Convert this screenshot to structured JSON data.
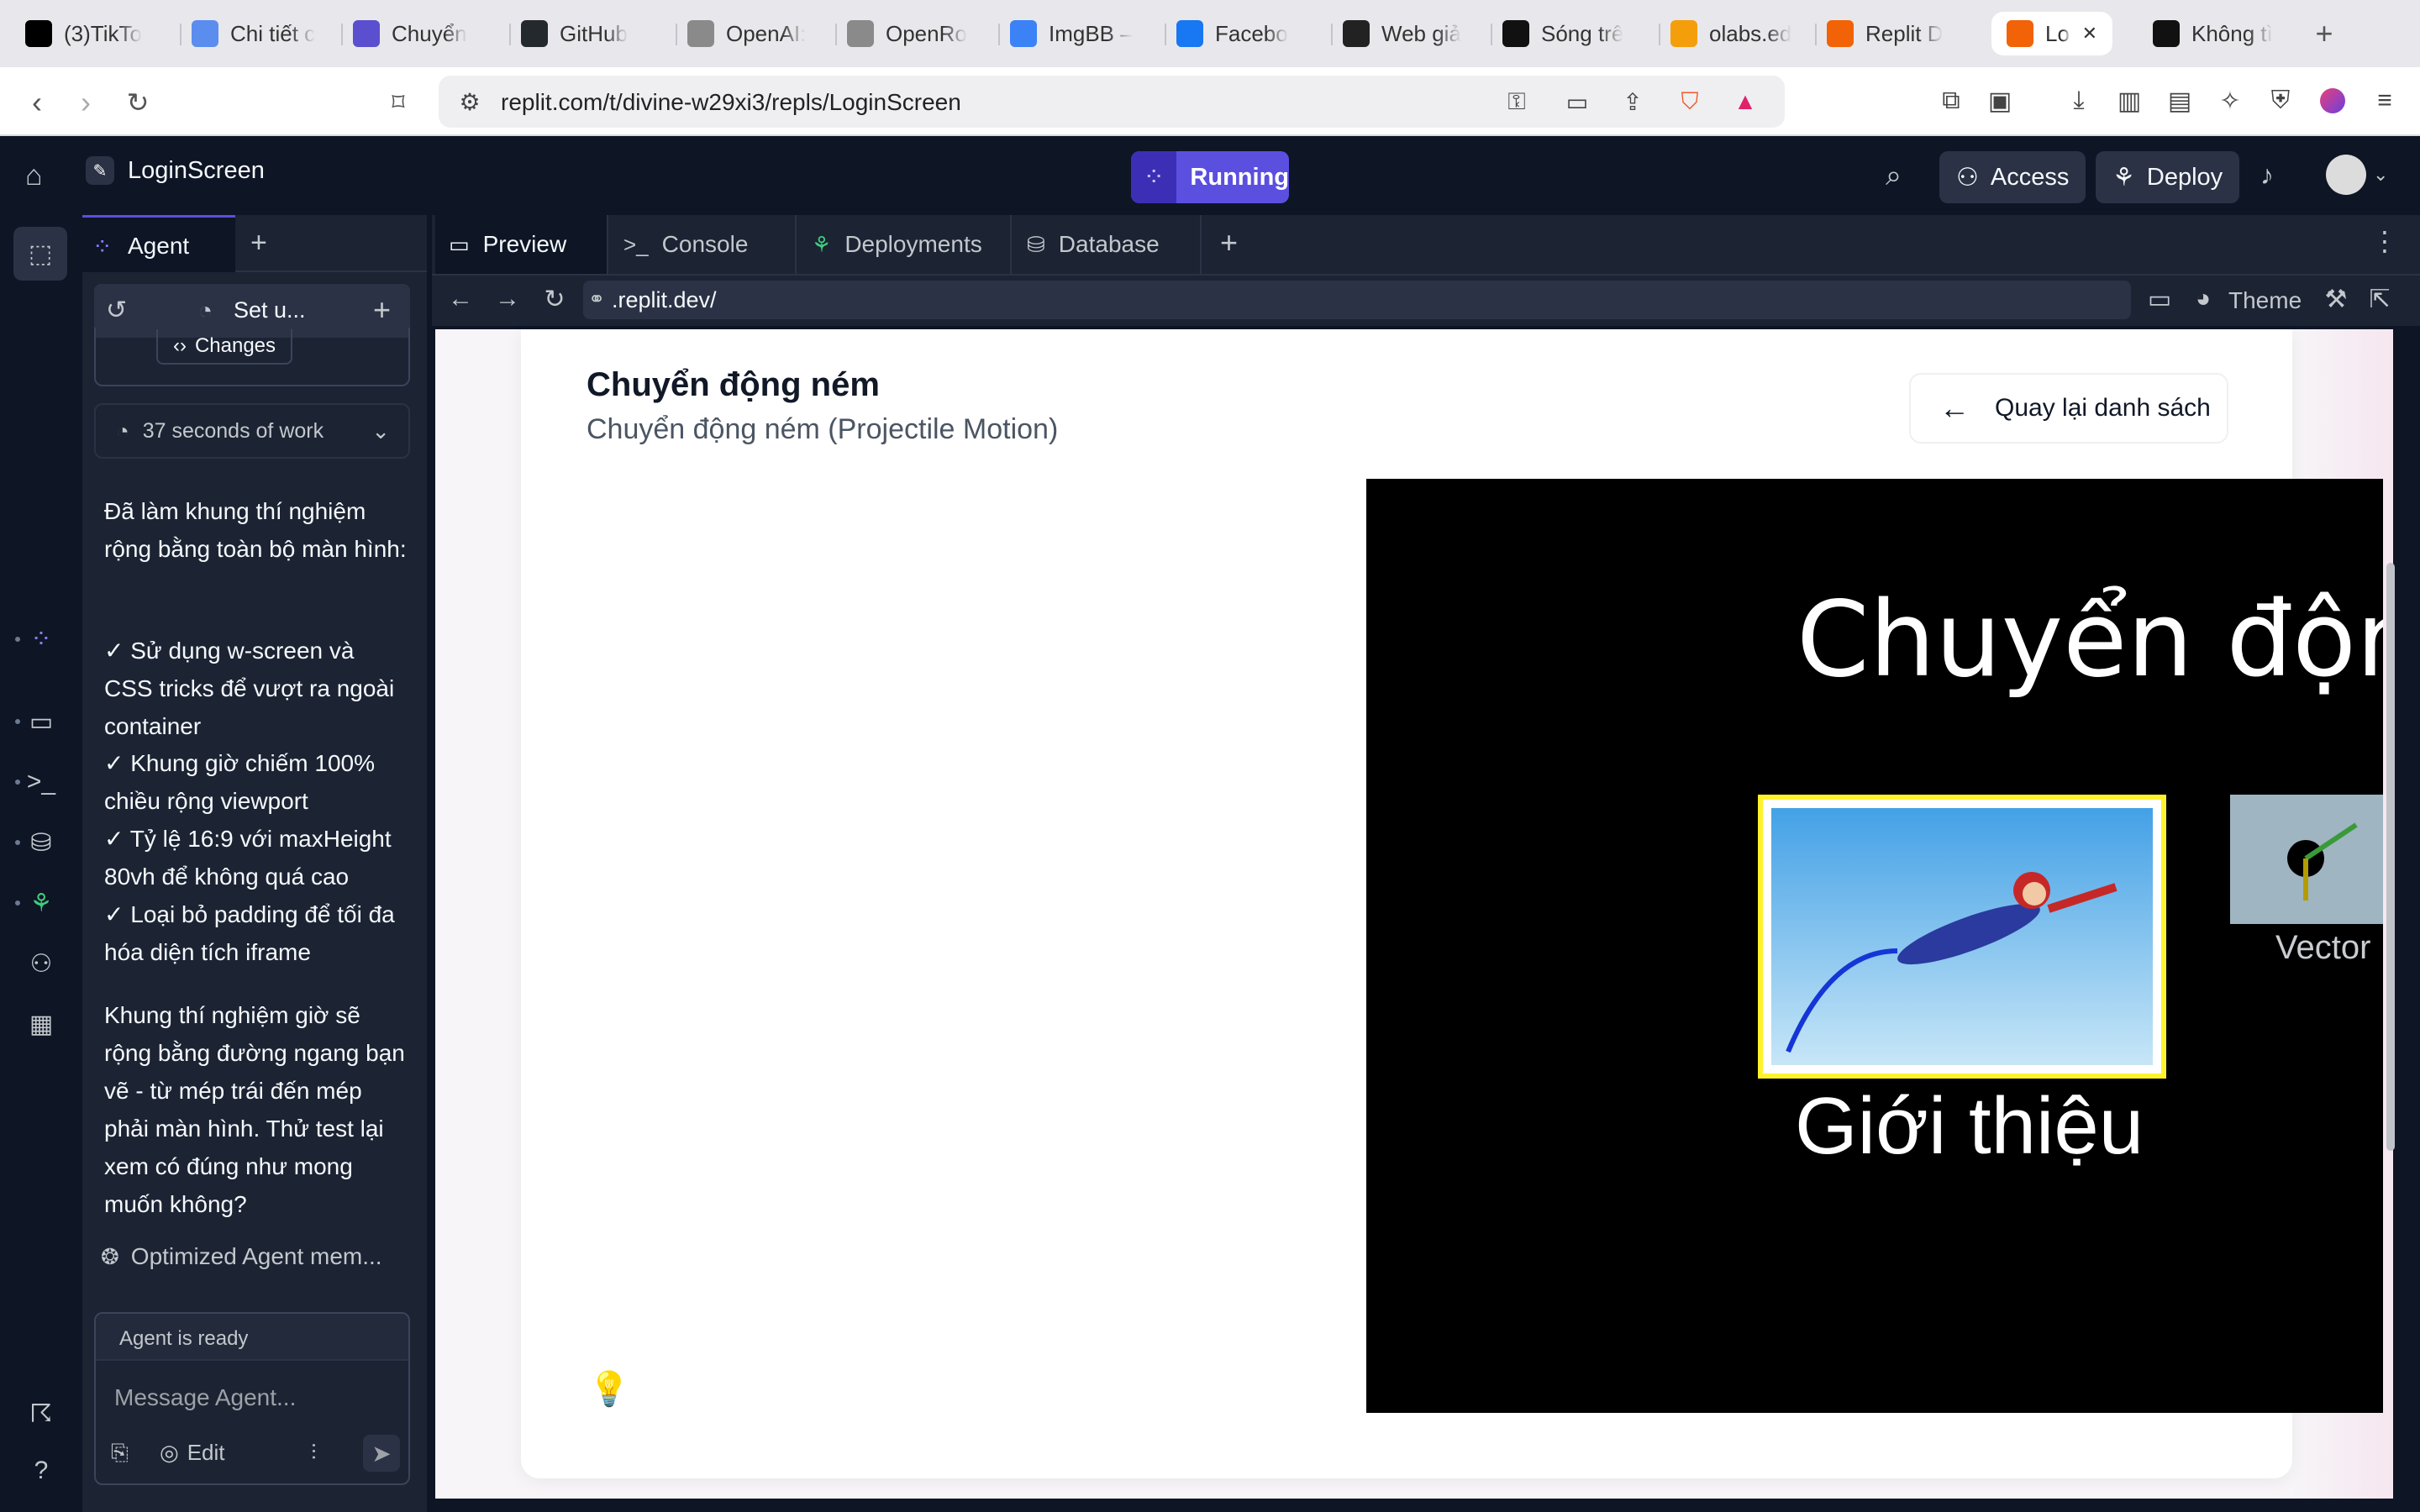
{
  "browser": {
    "tabs": [
      {
        "label": "(3)TikTo",
        "icon": "tiktok-icon",
        "color": "#000000"
      },
      {
        "label": "Chi tiết c",
        "icon": "page-icon",
        "color": "#5b8def"
      },
      {
        "label": "Chuyển",
        "icon": "hex-icon",
        "color": "#5b4fcf"
      },
      {
        "label": "GitHub",
        "icon": "github-icon",
        "color": "#24292e"
      },
      {
        "label": "OpenAI:",
        "icon": "openai-icon",
        "color": "#8a8a8a"
      },
      {
        "label": "OpenRo",
        "icon": "openrouter-icon",
        "color": "#8a8a8a"
      },
      {
        "label": "ImgBB –",
        "icon": "imgbb-icon",
        "color": "#3b82f6"
      },
      {
        "label": "Facebo",
        "icon": "facebook-icon",
        "color": "#1877f2"
      },
      {
        "label": "Web giả",
        "icon": "chatgpt-icon",
        "color": "#222222"
      },
      {
        "label": "Sóng trê",
        "icon": "phet-icon",
        "color": "#111111"
      },
      {
        "label": "olabs.ed",
        "icon": "olabs-icon",
        "color": "#f59e0b"
      },
      {
        "label": "Replit D",
        "icon": "replit-icon",
        "color": "#f26207"
      },
      {
        "label": "Logi",
        "icon": "replit-icon",
        "color": "#f26207",
        "active": true
      },
      {
        "label": "Không tì",
        "icon": "phet-icon",
        "color": "#111111"
      }
    ],
    "url": "replit.com/t/divine-w29xi3/repls/LoginScreen"
  },
  "replit": {
    "project_name": "LoginScreen",
    "run_status": "Running",
    "access_label": "Access",
    "deploy_label": "Deploy",
    "accent": "#5b4fe0"
  },
  "agent": {
    "tab_label": "Agent",
    "session_title": "Set u...",
    "changes_label": "Changes",
    "work_summary": "37 seconds of work",
    "message_intro": "Đã làm khung thí nghiệm rộng bằng toàn bộ màn hình:",
    "bullets": [
      "✓ Sử dụng w-screen và CSS tricks để vượt ra ngoài container",
      "✓ Khung giờ chiếm 100% chiều rộng viewport",
      "✓ Tỷ lệ 16:9 với maxHeight 80vh để không quá cao",
      "✓ Loại bỏ padding để tối đa hóa diện tích iframe"
    ],
    "message_outro": "Khung thí nghiệm giờ sẽ rộng bằng đường ngang bạn vẽ - từ mép trái đến mép phải màn hình. Thử test lại xem có đúng như mong muốn không?",
    "optimized_label": "Optimized Agent mem...",
    "status_label": "Agent is ready",
    "input_placeholder": "Message Agent...",
    "edit_label": "Edit"
  },
  "workspace": {
    "tabs": [
      {
        "label": "Preview",
        "icon": "monitor-icon"
      },
      {
        "label": "Console",
        "icon": "terminal-icon"
      },
      {
        "label": "Deployments",
        "icon": "deploy-icon"
      },
      {
        "label": "Database",
        "icon": "database-icon"
      }
    ],
    "preview_url": ".replit.dev/",
    "theme_label": "Theme"
  },
  "page": {
    "title": "Chuyển động ném",
    "subtitle": "Chuyển động ném (Projectile Motion)",
    "back_button": "Quay lại danh sách",
    "sim_title": "Chuyển động",
    "sim_tile_intro": "Giới thiệu",
    "sim_tile_vector": "Vector"
  }
}
